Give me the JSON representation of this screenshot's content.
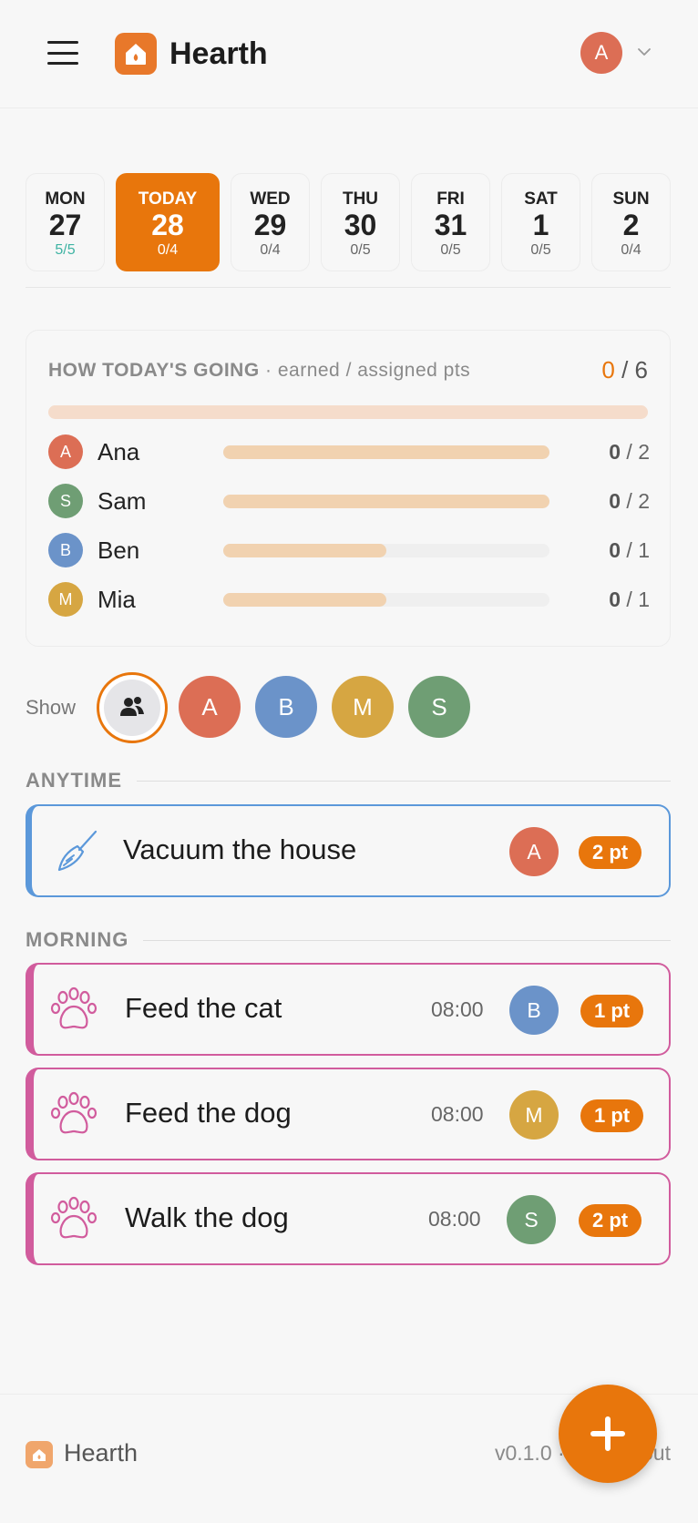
{
  "header": {
    "app_title": "Hearth",
    "user_initial": "A",
    "icons": {
      "menu": "hamburger-menu-icon",
      "logo": "home-flame-icon",
      "dropdown": "chevron-down-icon"
    }
  },
  "days": [
    {
      "name": "MON",
      "num": "27",
      "count": "5/5",
      "state": "done"
    },
    {
      "name": "TODAY",
      "num": "28",
      "count": "0/4",
      "state": "today"
    },
    {
      "name": "WED",
      "num": "29",
      "count": "0/4",
      "state": "normal"
    },
    {
      "name": "THU",
      "num": "30",
      "count": "0/5",
      "state": "normal"
    },
    {
      "name": "FRI",
      "num": "31",
      "count": "0/5",
      "state": "normal"
    },
    {
      "name": "SAT",
      "num": "1",
      "count": "0/5",
      "state": "normal"
    },
    {
      "name": "SUN",
      "num": "2",
      "count": "0/4",
      "state": "normal"
    }
  ],
  "progress": {
    "title": "HOW TODAY'S GOING",
    "subtitle": " · earned / assigned pts",
    "earned": "0",
    "assigned": "/ 6",
    "people": [
      {
        "initial": "A",
        "name": "Ana",
        "earned": "0",
        "assigned": " / 2",
        "assigned_fraction": 1.0,
        "color": "#dc6e55"
      },
      {
        "initial": "S",
        "name": "Sam",
        "earned": "0",
        "assigned": " / 2",
        "assigned_fraction": 1.0,
        "color": "#6f9e74"
      },
      {
        "initial": "B",
        "name": "Ben",
        "earned": "0",
        "assigned": " / 1",
        "assigned_fraction": 0.5,
        "color": "#6b93c9"
      },
      {
        "initial": "M",
        "name": "Mia",
        "earned": "0",
        "assigned": " / 1",
        "assigned_fraction": 0.5,
        "color": "#d6a642"
      }
    ]
  },
  "filter": {
    "label": "Show",
    "all_icon": "people-group-icon",
    "members": [
      {
        "initial": "A",
        "color": "#dc6e55"
      },
      {
        "initial": "B",
        "color": "#6b93c9"
      },
      {
        "initial": "M",
        "color": "#d6a642"
      },
      {
        "initial": "S",
        "color": "#6f9e74"
      }
    ]
  },
  "sections": {
    "anytime": "ANYTIME",
    "morning": "MORNING"
  },
  "chores": {
    "anytime": [
      {
        "title": "Vacuum the house",
        "time": "",
        "initial": "A",
        "avatar_color": "#dc6e55",
        "points": "2 pt",
        "icon": "broom-icon",
        "accent": "#5b98da"
      }
    ],
    "morning": [
      {
        "title": "Feed the cat",
        "time": "08:00",
        "initial": "B",
        "avatar_color": "#6b93c9",
        "points": "1 pt",
        "icon": "paw-icon",
        "accent": "#d15c9d"
      },
      {
        "title": "Feed the dog",
        "time": "08:00",
        "initial": "M",
        "avatar_color": "#d6a642",
        "points": "1 pt",
        "icon": "paw-icon",
        "accent": "#d15c9d"
      },
      {
        "title": "Walk the dog",
        "time": "08:00",
        "initial": "S",
        "avatar_color": "#6f9e74",
        "points": "2 pt",
        "icon": "paw-icon",
        "accent": "#d15c9d"
      }
    ]
  },
  "footer": {
    "name": "Hearth",
    "meta": "v0.1.0 · demo · out",
    "fab_icon": "plus-icon"
  },
  "colors": {
    "accent": "#e8760c",
    "done": "#3eb3a3"
  }
}
